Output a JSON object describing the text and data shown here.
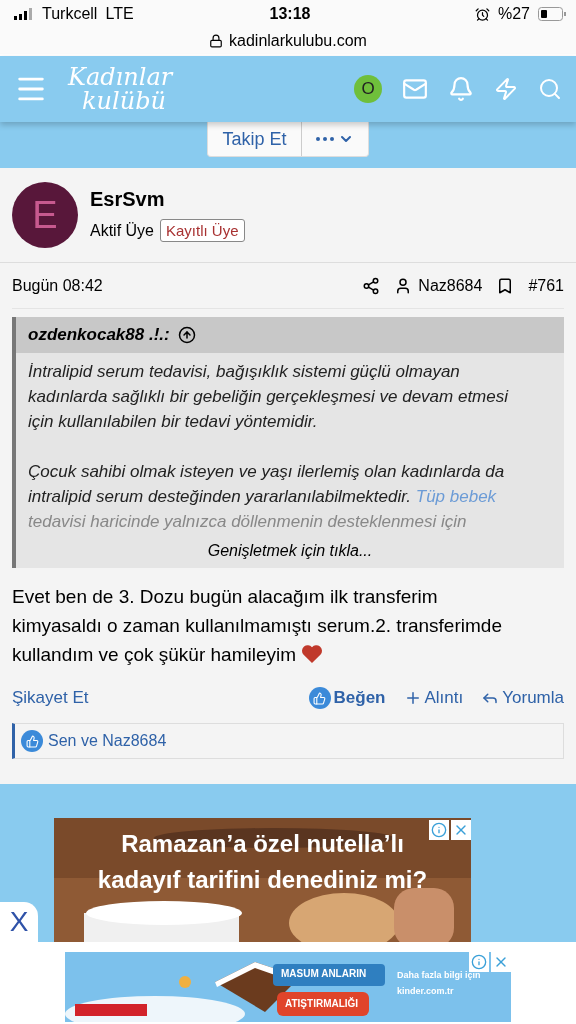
{
  "status_bar": {
    "carrier": "Turkcell",
    "network": "LTE",
    "time": "13:18",
    "battery": "%27"
  },
  "address_bar": {
    "url": "kadinlarkulubu.com"
  },
  "header": {
    "logo_lines": [
      "Kadınlar",
      "kulübü"
    ],
    "avatar_letter": "O"
  },
  "follow_bar": {
    "follow": "Takip Et"
  },
  "post": {
    "author": "EsrSvm",
    "avatar_letter": "E",
    "user_title": "Aktif Üye",
    "badge": "Kayıtlı Üye",
    "date": "Bugün 08:42",
    "mention": "Naz8684",
    "number": "#761",
    "quote": {
      "author": "ozdenkocak88 .!.:",
      "paragraphs": [
        {
          "text": "İntralipid serum tedavisi, bağışıklık sistemi güçlü olmayan kadınlarda sağlıklı bir gebeliğin gerçekleşmesi ve devam etmesi için kullanılabilen bir tedavi yöntemidir."
        },
        {
          "text": "Çocuk sahibi olmak isteyen ve yaşı ilerlemiş olan kadınlarda da intralipid serum desteğinden yararlanılabilmektedir.",
          "link": "Tüp bebek",
          "after": "tedavisi haricinde yalnızca döllenmenin desteklenmesi için"
        }
      ],
      "expand": "Genişletmek için tıkla..."
    },
    "body": "Evet ben de 3. Dozu bugün alacağım ilk transferim kimyasaldı o zaman kullanılmamıştı serum.2. transferimde kullandım ve çok şükür hamileyim",
    "actions": {
      "report": "Şikayet Et",
      "like": "Beğen",
      "quote": "Alıntı",
      "reply": "Yorumla"
    },
    "reactions": "Sen ve Naz8684"
  },
  "ads": {
    "close": "X",
    "banner_1": {
      "kind": "picture",
      "headline": [
        "Ramazan’a özel nutella’lı",
        "kadayıf tarifini denediniz mi?"
      ]
    },
    "banner_2": {
      "kind": "picture",
      "lines": [
        "MASUM ANLARIN",
        "ATIŞTIRMALIĞI"
      ],
      "more": "Daha fazla bilgi için",
      "site": "kinder.com.tr"
    }
  }
}
